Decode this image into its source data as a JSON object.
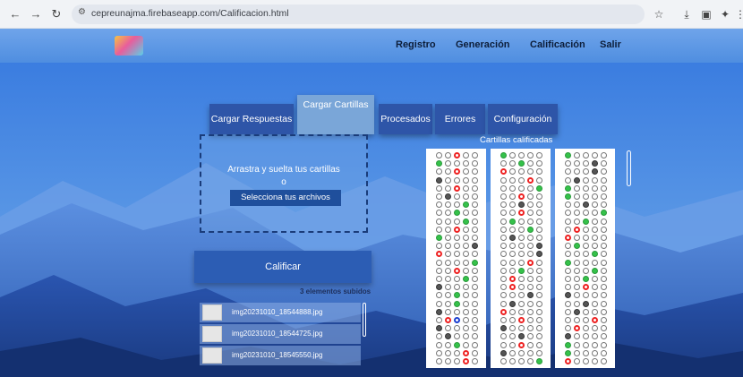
{
  "browser": {
    "url": "cepreunajma.firebaseapp.com/Calificacion.html",
    "back_icon": "arrow-left",
    "forward_icon": "arrow-right",
    "reload_icon": "reload"
  },
  "nav": {
    "links": [
      "Registro",
      "Generación",
      "Calificación",
      "Salir"
    ]
  },
  "tabs": [
    "Cargar Respuestas",
    "Cargar Cartillas",
    "Procesados",
    "Errores",
    "Configuración"
  ],
  "active_tab": "Cargar Cartillas",
  "dropzone": {
    "line1": "Arrastra y suelta tus cartillas",
    "line2": "o",
    "button": "Selecciona tus archivos"
  },
  "calificar_label": "Calificar",
  "uploaded_text": "3 elementos subidos",
  "files": [
    "img20231010_18544888.jpg",
    "img20231010_18544725.jpg",
    "img20231010_18545550.jpg"
  ],
  "cards_title": "Cartillas calificadas",
  "colors": {
    "accent": "#2c5db4",
    "correct": "#35c24a",
    "wrong": "#e22222"
  }
}
